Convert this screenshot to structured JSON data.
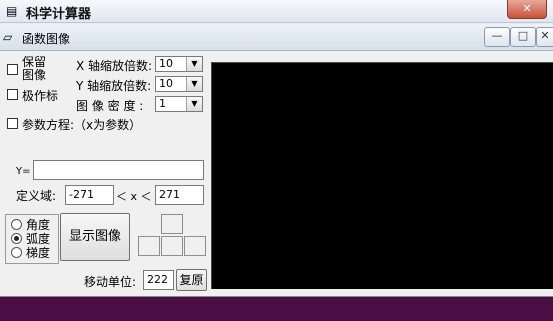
{
  "parent_window": {
    "title": "科学计算器",
    "close_label": "✕"
  },
  "child_window": {
    "title": "函数图像",
    "controls": {
      "minimize": "—",
      "maximize": "□",
      "close": "✕"
    }
  },
  "options": {
    "keep_image_line1": "保留",
    "keep_image_line2": "图像",
    "polar": "极作标",
    "parametric": "参数方程:（x为参数）"
  },
  "scales": {
    "x_label": "X 轴缩放倍数:",
    "x_value": "10",
    "y_label": "Y 轴缩放倍数:",
    "y_value": "10",
    "density_label": "图 像 密 度 :",
    "density_value": "1"
  },
  "function": {
    "y_label": "Y=",
    "y_value": ""
  },
  "domain": {
    "label": "定义域:",
    "min": "-271",
    "middle": "＜ x ＜",
    "max": "271"
  },
  "angle_units": [
    {
      "label": "角度",
      "checked": false
    },
    {
      "label": "弧度",
      "checked": true
    },
    {
      "label": "梯度",
      "checked": false
    }
  ],
  "buttons": {
    "show_image": "显示图像",
    "reset": "复原"
  },
  "move_unit": {
    "label": "移动单位:",
    "value": "222"
  }
}
